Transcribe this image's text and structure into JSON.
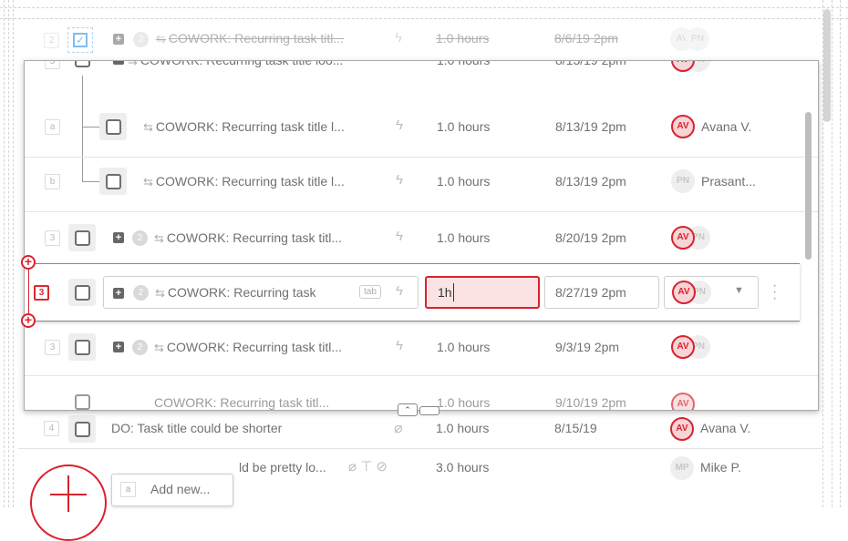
{
  "rows_top": [
    {
      "num": "2",
      "count": "2",
      "title": "COWORK: Recurring task titl...",
      "hours": "1.0 hours",
      "date": "8/6/19 2pm",
      "av1": "AV",
      "av2": "PN"
    }
  ],
  "panel": {
    "row_cut": {
      "num": "3",
      "title": "COWORK: Recurring task title loo...",
      "hours": "1.0 hours",
      "date": "8/13/19 2pm",
      "av1": "AV",
      "av2": "PN"
    },
    "sub_a": {
      "num": "a",
      "title": "COWORK: Recurring task title l...",
      "hours": "1.0 hours",
      "date": "8/13/19 2pm",
      "av": "AV",
      "name": "Avana V."
    },
    "sub_b": {
      "num": "b",
      "title": "COWORK: Recurring task title l...",
      "hours": "1.0 hours",
      "date": "8/13/19 2pm",
      "av": "PN",
      "name": "Prasant..."
    },
    "row_3a": {
      "num": "3",
      "count": "2",
      "title": "COWORK: Recurring task titl...",
      "hours": "1.0 hours",
      "date": "8/20/19 2pm",
      "av1": "AV",
      "av2": "PN"
    },
    "edit_row": {
      "num": "3",
      "count": "2",
      "title": "COWORK: Recurring task",
      "tab_hint": "tab",
      "hours_value": "1h",
      "date": "8/27/19 2pm",
      "av1": "AV",
      "av2": "PN"
    },
    "row_3c": {
      "num": "3",
      "count": "2",
      "title": "COWORK: Recurring task titl...",
      "hours": "1.0 hours",
      "date": "9/3/19 2pm",
      "av1": "AV",
      "av2": "PN"
    },
    "row_cut_bottom": {
      "title": "COWORK: Recurring task titl...",
      "hours": "1.0 hours",
      "date": "9/10/19 2pm",
      "av1": "AV"
    }
  },
  "rows_bottom": [
    {
      "num": "4",
      "title": "DO: Task title could be shorter",
      "hours": "1.0 hours",
      "date": "8/15/19",
      "av": "AV",
      "name": "Avana V."
    },
    {
      "title_tail": "ld be pretty lo...",
      "hours": "3.0 hours",
      "av": "MP",
      "name": "Mike P."
    }
  ],
  "add_new": {
    "key": "a",
    "label": "Add new..."
  },
  "colors": {
    "accent": "#d9232e",
    "checked": "#1e88e5"
  }
}
